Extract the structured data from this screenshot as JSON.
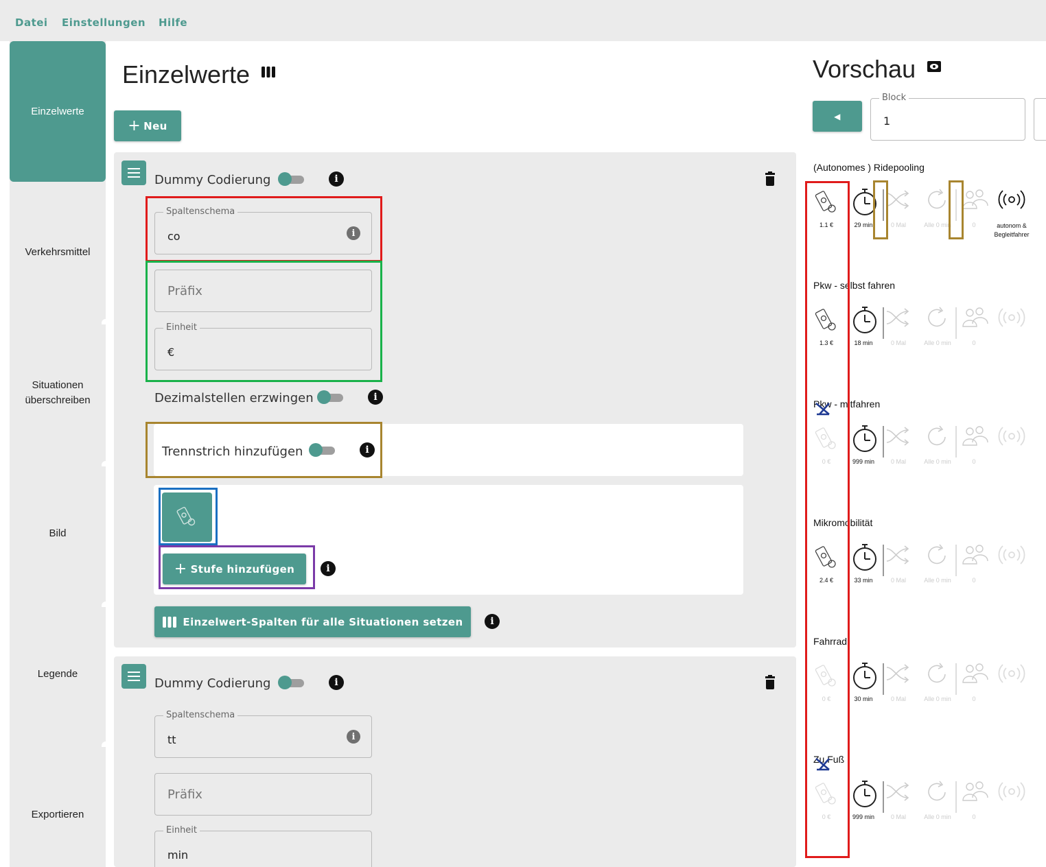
{
  "menu": [
    "Datei",
    "Einstellungen",
    "Hilfe"
  ],
  "sidebar": [
    {
      "label": "Einzelwerte",
      "active": true
    },
    {
      "label": "Verkehrsmittel"
    },
    {
      "label": "Situationen überschreiben"
    },
    {
      "label": "Bild"
    },
    {
      "label": "Legende"
    },
    {
      "label": "Exportieren"
    }
  ],
  "main": {
    "title": "Einzelwerte",
    "new_button": "Neu",
    "cards": [
      {
        "name_label": "Dummy Codierung",
        "spaltenschema": {
          "label": "Spaltenschema",
          "value": "co"
        },
        "praefix": {
          "placeholder": "Präfix"
        },
        "einheit": {
          "label": "Einheit",
          "value": "€"
        },
        "dezimal_label": "Dezimalstellen erzwingen",
        "trennstrich_label": "Trennstrich hinzufügen",
        "stufe_button": "Stufe hinzufügen",
        "set_all_button": "Einzelwert-Spalten für alle Situationen setzen"
      },
      {
        "name_label": "Dummy Codierung",
        "spaltenschema": {
          "label": "Spaltenschema",
          "value": "tt"
        },
        "praefix": {
          "placeholder": "Präfix"
        },
        "einheit": {
          "label": "Einheit",
          "value": "min"
        }
      }
    ]
  },
  "preview": {
    "title": "Vorschau",
    "block_label": "Block",
    "block_value": "1",
    "modes": [
      {
        "name": "(Autonomes ) Ridepooling",
        "cost": "1.1 €",
        "time": "29 min",
        "switch": "0 Mal",
        "freq": "Alle 0 min",
        "people": "0",
        "extra": "autonom & Begleitfahrer",
        "cost_active": true,
        "extra_active": true
      },
      {
        "name": "Pkw - selbst fahren",
        "cost": "1.3 €",
        "time": "18 min",
        "switch": "0 Mal",
        "freq": "Alle 0 min",
        "people": "0",
        "extra": "",
        "cost_active": true,
        "extra_active": false
      },
      {
        "name": "Pkw - mitfahren",
        "cost": "0 €",
        "time": "999 min",
        "switch": "0 Mal",
        "freq": "Alle 0 min",
        "people": "0",
        "extra": "",
        "cost_active": false,
        "extra_active": false
      },
      {
        "name": "Mikromobilität",
        "cost": "2.4 €",
        "time": "33 min",
        "switch": "0 Mal",
        "freq": "Alle 0 min",
        "people": "0",
        "extra": "",
        "cost_active": true,
        "extra_active": false
      },
      {
        "name": "Fahrrad",
        "cost": "0 €",
        "time": "30 min",
        "switch": "0 Mal",
        "freq": "Alle 0 min",
        "people": "0",
        "extra": "",
        "cost_active": false,
        "extra_active": false
      },
      {
        "name": "Zu Fuß",
        "cost": "0 €",
        "time": "999 min",
        "switch": "0 Mal",
        "freq": "Alle 0 min",
        "people": "0",
        "extra": "",
        "cost_active": false,
        "extra_active": false
      }
    ]
  },
  "colors": {
    "accent": "#4e9a8f",
    "panel_bg": "#ebebeb",
    "annotation_red": "#e01b1b",
    "annotation_green": "#19b24a",
    "annotation_gold": "#a8852f",
    "annotation_blue": "#1a6fc2",
    "annotation_purple": "#7b3aa8"
  }
}
